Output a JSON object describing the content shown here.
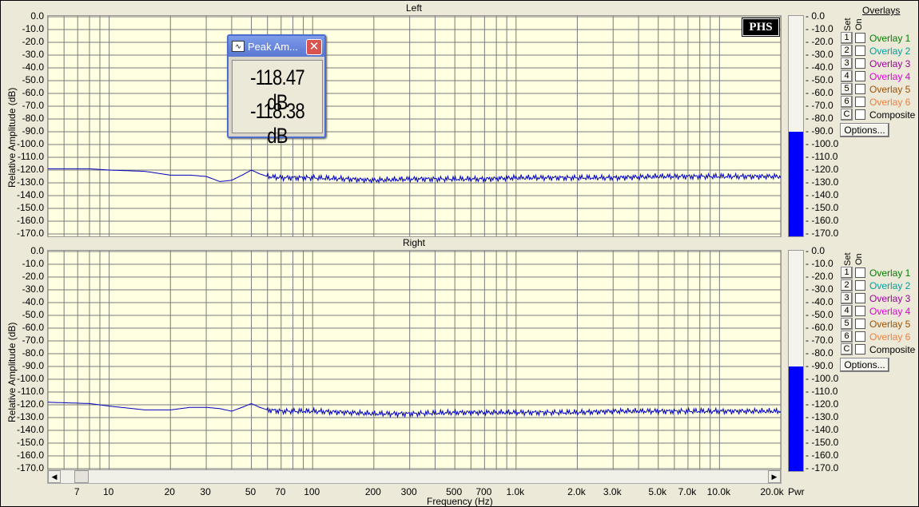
{
  "panels": [
    {
      "title": "Left",
      "yaxis_title": "Relative Amplitude (dB)",
      "yticks": [
        "0.0",
        "-10.0",
        "-20.0",
        "-30.0",
        "-40.0",
        "-50.0",
        "-60.0",
        "-70.0",
        "-80.0",
        "-90.0",
        "-100.0",
        "-110.0",
        "-120.0",
        "-130.0",
        "-140.0",
        "-150.0",
        "-160.0",
        "-170.0"
      ],
      "meter_level_db": -90
    },
    {
      "title": "Right",
      "yaxis_title": "Relative Amplitude (dB)",
      "yticks": [
        "0.0",
        "-10.0",
        "-20.0",
        "-30.0",
        "-40.0",
        "-50.0",
        "-60.0",
        "-70.0",
        "-80.0",
        "-90.0",
        "-100.0",
        "-110.0",
        "-120.0",
        "-130.0",
        "-140.0",
        "-150.0",
        "-160.0",
        "-170.0"
      ],
      "meter_level_db": -90
    }
  ],
  "overlays": {
    "header": "Overlays",
    "set_label": "Set",
    "on_label": "On",
    "items": [
      {
        "set": "1",
        "name": "Overlay 1",
        "color": "#008000"
      },
      {
        "set": "2",
        "name": "Overlay 2",
        "color": "#00a0a0"
      },
      {
        "set": "3",
        "name": "Overlay 3",
        "color": "#a000a0"
      },
      {
        "set": "4",
        "name": "Overlay 4",
        "color": "#e000e0"
      },
      {
        "set": "5",
        "name": "Overlay 5",
        "color": "#a05000"
      },
      {
        "set": "6",
        "name": "Overlay 6",
        "color": "#f08040"
      },
      {
        "set": "C",
        "name": "Composite",
        "color": "#000000"
      }
    ],
    "options_label": "Options..."
  },
  "popup": {
    "title": "Peak Am...",
    "icon": "waveform-icon",
    "close": "✕",
    "values": [
      "-118.47 dB",
      "-118.38 dB"
    ]
  },
  "logo": "PHS",
  "xaxis": {
    "title": "Frequency (Hz)",
    "ticks": [
      {
        "f": 7,
        "label": "7"
      },
      {
        "f": 10,
        "label": "10"
      },
      {
        "f": 20,
        "label": "20"
      },
      {
        "f": 30,
        "label": "30"
      },
      {
        "f": 50,
        "label": "50"
      },
      {
        "f": 70,
        "label": "70"
      },
      {
        "f": 100,
        "label": "100"
      },
      {
        "f": 200,
        "label": "200"
      },
      {
        "f": 300,
        "label": "300"
      },
      {
        "f": 500,
        "label": "500"
      },
      {
        "f": 700,
        "label": "700"
      },
      {
        "f": 1000,
        "label": "1.0k"
      },
      {
        "f": 2000,
        "label": "2.0k"
      },
      {
        "f": 3000,
        "label": "3.0k"
      },
      {
        "f": 5000,
        "label": "5.0k"
      },
      {
        "f": 7000,
        "label": "7.0k"
      },
      {
        "f": 10000,
        "label": "10.0k"
      },
      {
        "f": 20000,
        "label": "20.0k"
      }
    ],
    "pwr_label": "Pwr",
    "scale": "log",
    "range_hz": [
      5,
      20000
    ]
  },
  "chart_data": [
    {
      "type": "line",
      "title": "Left",
      "xlabel": "Frequency (Hz)",
      "ylabel": "Relative Amplitude (dB)",
      "xscale": "log",
      "xlim": [
        5,
        20000
      ],
      "ylim": [
        -170,
        0
      ],
      "grid": true,
      "series": [
        {
          "x": [
            5,
            8,
            10,
            15,
            20,
            25,
            30,
            35,
            40,
            45,
            50,
            55,
            60,
            70,
            100,
            150,
            200,
            300,
            500,
            700,
            1000,
            2000,
            3000,
            5000,
            7000,
            10000,
            15000,
            20000
          ],
          "y": [
            -119,
            -119,
            -120,
            -121,
            -124,
            -124,
            -125,
            -129,
            -128,
            -124,
            -120,
            -123,
            -125,
            -126,
            -126,
            -127,
            -128,
            -127,
            -127,
            -127,
            -126,
            -126,
            -126,
            -125,
            -125,
            -125,
            -125,
            -125
          ]
        }
      ]
    },
    {
      "type": "line",
      "title": "Right",
      "xlabel": "Frequency (Hz)",
      "ylabel": "Relative Amplitude (dB)",
      "xscale": "log",
      "xlim": [
        5,
        20000
      ],
      "ylim": [
        -170,
        0
      ],
      "grid": true,
      "series": [
        {
          "x": [
            5,
            8,
            10,
            15,
            20,
            25,
            30,
            35,
            40,
            45,
            50,
            55,
            60,
            70,
            100,
            150,
            200,
            300,
            500,
            700,
            1000,
            2000,
            3000,
            5000,
            7000,
            10000,
            15000,
            20000
          ],
          "y": [
            -118,
            -119,
            -121,
            -124,
            -124,
            -122,
            -122,
            -123,
            -125,
            -122,
            -119,
            -122,
            -124,
            -125,
            -125,
            -126,
            -127,
            -127,
            -126,
            -126,
            -126,
            -126,
            -125,
            -125,
            -125,
            -125,
            -125,
            -125
          ]
        }
      ]
    }
  ]
}
